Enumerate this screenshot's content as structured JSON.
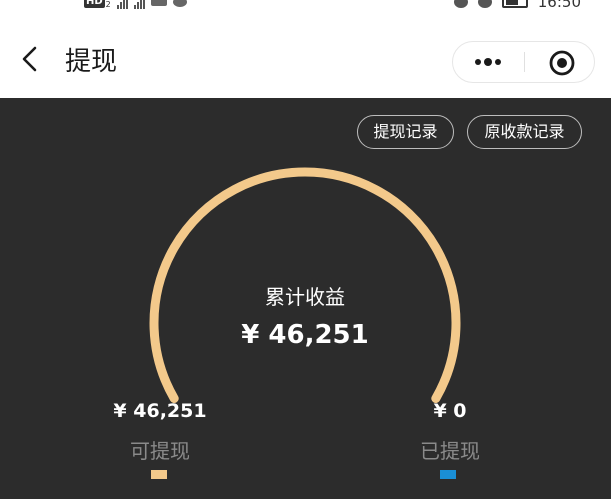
{
  "status_bar": {
    "hd_badge": "HD",
    "hd_sub": "2",
    "time": "16:50"
  },
  "header": {
    "title": "提现"
  },
  "buttons": {
    "records": "提现记录",
    "original_records": "原收款记录"
  },
  "summary": {
    "label": "累计收益",
    "value": "¥ 46,251"
  },
  "available": {
    "amount": "¥ 46,251",
    "label": "可提现",
    "color": "#f3c98b",
    "fraction": 1.0
  },
  "withdrawn": {
    "amount": "¥ 0",
    "label": "已提现",
    "color": "#1a8fd6",
    "fraction": 0.0
  },
  "colors": {
    "panel_bg": "#2c2c2c",
    "arc": "#f3c98b"
  }
}
